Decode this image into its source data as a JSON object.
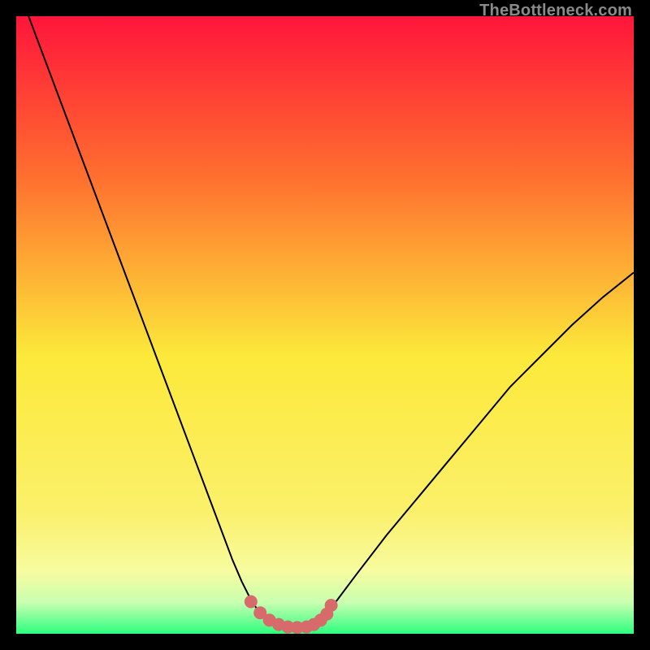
{
  "watermark": "TheBottleneck.com",
  "colors": {
    "background": "#000000",
    "gradient_top": "#ff153b",
    "gradient_upper_mid": "#ff7a2f",
    "gradient_mid": "#fce93a",
    "gradient_lower_mid": "#f7fca0",
    "gradient_bottom": "#2cff7e",
    "curve": "#000000",
    "dots": "#d76a6a"
  },
  "chart_data": {
    "type": "line",
    "title": "",
    "xlabel": "",
    "ylabel": "",
    "xlim": [
      0,
      100
    ],
    "ylim": [
      0,
      100
    ],
    "series": [
      {
        "name": "bottleneck-curve",
        "x": [
          2,
          5,
          8,
          11,
          14,
          17,
          20,
          23,
          26,
          29,
          32,
          33.5,
          35,
          36.5,
          38,
          39,
          40,
          41,
          42,
          43,
          44,
          45,
          46,
          47,
          48,
          49,
          50,
          52,
          55,
          60,
          65,
          70,
          75,
          80,
          85,
          90,
          95,
          100
        ],
        "y": [
          100,
          92,
          84,
          76,
          68,
          60,
          52,
          44,
          36,
          28,
          20,
          16,
          12,
          8.5,
          5.5,
          4,
          2.8,
          2,
          1.4,
          1.1,
          1,
          1,
          1,
          1.1,
          1.4,
          2,
          3,
          5.5,
          9.5,
          16,
          22,
          28,
          34,
          40,
          45,
          50,
          54.5,
          58.5
        ]
      }
    ],
    "marker_points": {
      "name": "trough-dots",
      "x": [
        38,
        39.5,
        41,
        42.5,
        44,
        45.5,
        47,
        48.2,
        49.3,
        50.3,
        51
      ],
      "y": [
        5.2,
        3.4,
        2.2,
        1.5,
        1.1,
        1.0,
        1.1,
        1.5,
        2.2,
        3.2,
        4.6
      ]
    }
  }
}
